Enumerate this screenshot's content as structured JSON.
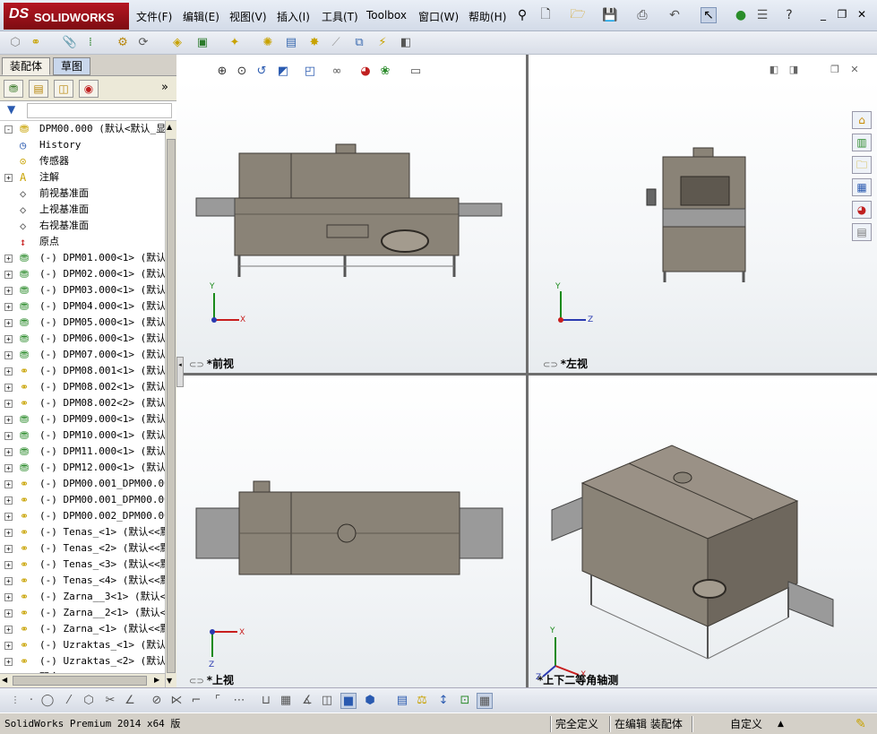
{
  "app": {
    "logo_ds": "DS",
    "logo_text": "SOLIDWORKS"
  },
  "menu": [
    "文件(F)",
    "编辑(E)",
    "视图(V)",
    "插入(I)",
    "工具(T)",
    "Toolbox",
    "窗口(W)",
    "帮助(H)"
  ],
  "left_panel": {
    "tab_assembly": "装配体",
    "tab_sketch": "草图",
    "tree": [
      {
        "label": "DPM00.000  (默认<默认_显示",
        "icon": "assembly",
        "expand": "-"
      },
      {
        "label": "History",
        "icon": "history",
        "expand": ""
      },
      {
        "label": "传感器",
        "icon": "sensor",
        "expand": ""
      },
      {
        "label": "注解",
        "icon": "annotation",
        "expand": "+"
      },
      {
        "label": "前视基准面",
        "icon": "plane",
        "expand": ""
      },
      {
        "label": "上视基准面",
        "icon": "plane",
        "expand": ""
      },
      {
        "label": "右视基准面",
        "icon": "plane",
        "expand": ""
      },
      {
        "label": "原点",
        "icon": "origin",
        "expand": ""
      },
      {
        "label": "(-) DPM01.000<1> (默认<",
        "icon": "subassembly",
        "expand": "+"
      },
      {
        "label": "(-) DPM02.000<1> (默认<",
        "icon": "subassembly",
        "expand": "+"
      },
      {
        "label": "(-) DPM03.000<1> (默认<",
        "icon": "subassembly",
        "expand": "+"
      },
      {
        "label": "(-) DPM04.000<1> (默认<",
        "icon": "subassembly",
        "expand": "+"
      },
      {
        "label": "(-) DPM05.000<1> (默认<",
        "icon": "subassembly",
        "expand": "+"
      },
      {
        "label": "(-) DPM06.000<1> (默认<",
        "icon": "subassembly",
        "expand": "+"
      },
      {
        "label": "(-) DPM07.000<1> (默认<",
        "icon": "subassembly",
        "expand": "+"
      },
      {
        "label": "(-) DPM08.001<1> (默认<",
        "icon": "part",
        "expand": "+"
      },
      {
        "label": "(-) DPM08.002<1> (默认<",
        "icon": "part",
        "expand": "+"
      },
      {
        "label": "(-) DPM08.002<2> (默认<",
        "icon": "part",
        "expand": "+"
      },
      {
        "label": "(-) DPM09.000<1> (默认<",
        "icon": "subassembly",
        "expand": "+"
      },
      {
        "label": "(-) DPM10.000<1> (默认<",
        "icon": "subassembly",
        "expand": "+"
      },
      {
        "label": "(-) DPM11.000<1> (默认<",
        "icon": "subassembly",
        "expand": "+"
      },
      {
        "label": "(-) DPM12.000<1> (默认<",
        "icon": "subassembly",
        "expand": "+"
      },
      {
        "label": "(-) DPM00.001_DPM00.001",
        "icon": "part",
        "expand": "+"
      },
      {
        "label": "(-) DPM00.001_DPM00.001",
        "icon": "part",
        "expand": "+"
      },
      {
        "label": "(-) DPM00.002_DPM00.002",
        "icon": "part",
        "expand": "+"
      },
      {
        "label": "(-) Tenas_<1> (默认<<默",
        "icon": "part",
        "expand": "+"
      },
      {
        "label": "(-) Tenas_<2> (默认<<默",
        "icon": "part",
        "expand": "+"
      },
      {
        "label": "(-) Tenas_<3> (默认<<默",
        "icon": "part",
        "expand": "+"
      },
      {
        "label": "(-) Tenas_<4> (默认<<默",
        "icon": "part",
        "expand": "+"
      },
      {
        "label": "(-) Zarna__3<1> (默认<<",
        "icon": "part",
        "expand": "+"
      },
      {
        "label": "(-) Zarna__2<1> (默认<<",
        "icon": "part",
        "expand": "+"
      },
      {
        "label": "(-) Zarna_<1> (默认<<默",
        "icon": "part",
        "expand": "+"
      },
      {
        "label": "(-) Uzraktas_<1> (默认<",
        "icon": "part",
        "expand": "+"
      },
      {
        "label": "(-) Uzraktas_<2> (默认<",
        "icon": "part",
        "expand": "+"
      },
      {
        "label": "配合",
        "icon": "mates",
        "expand": "+"
      }
    ]
  },
  "viewports": {
    "front": {
      "label": "*前视",
      "axis1": "Y",
      "axis2": "X"
    },
    "left": {
      "label": "*左视",
      "axis1": "Y",
      "axis2": "Z"
    },
    "top": {
      "label": "*上视",
      "axis1": "X",
      "axis2": "Z"
    },
    "iso": {
      "label": "*上下二等角轴测",
      "axis1": "Y",
      "axis2": "X",
      "axis3": "Z"
    }
  },
  "status": {
    "product": "SolidWorks Premium 2014 x64 版",
    "defined": "完全定义",
    "editing": "在编辑 装配体",
    "units": "自定义"
  },
  "colors": {
    "model": "#8a8377",
    "model_dark": "#5e584f",
    "frame": "#9a9a9a",
    "logo": "#b51622"
  }
}
